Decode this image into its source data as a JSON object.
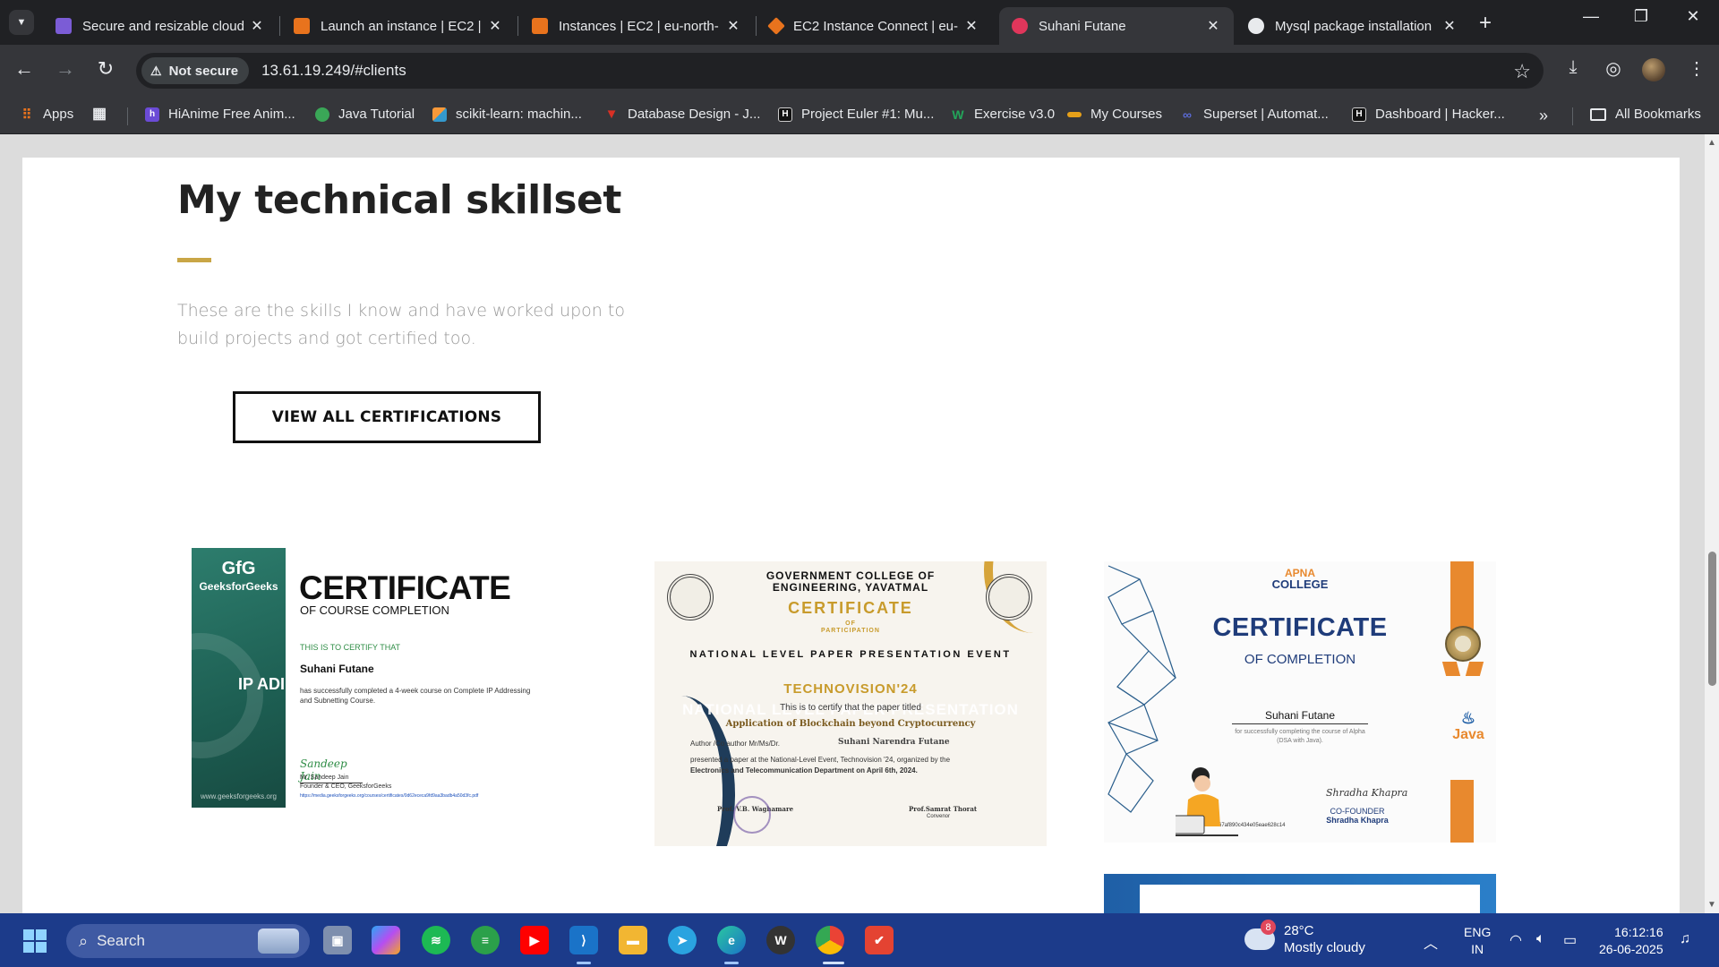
{
  "browser": {
    "tabs": [
      {
        "title": "Secure and resizable cloud",
        "favicon_color": "#7b5cd6"
      },
      {
        "title": "Launch an instance | EC2 | e",
        "favicon_color": "#e8731d"
      },
      {
        "title": "Instances | EC2 | eu-north-",
        "favicon_color": "#e8731d"
      },
      {
        "title": "EC2 Instance Connect | eu-",
        "favicon_color": "#e8731d"
      },
      {
        "title": "Suhani Futane",
        "favicon_color": "#e0365b",
        "active": true
      },
      {
        "title": "Mysql package installation",
        "favicon_color": "#e8eaed"
      }
    ],
    "new_tab_label": "+",
    "address": {
      "security_label": "Not secure",
      "url": "13.61.19.249/#clients"
    },
    "bookmarks": [
      {
        "label": "Apps",
        "icon_color": "#e8731d"
      },
      {
        "label": "HiAnime Free Anim...",
        "icon_color": "#6b4bd6"
      },
      {
        "label": "Java Tutorial",
        "icon_color": "#3aa757"
      },
      {
        "label": "scikit-learn: machin...",
        "icon_color": "#3499cd"
      },
      {
        "label": "Database Design - J...",
        "icon_color": "#d93025"
      },
      {
        "label": "Project Euler #1: Mu...",
        "icon_color": "#111111"
      },
      {
        "label": "Exercise v3.0",
        "icon_color": "#23a55a"
      },
      {
        "label": "My Courses",
        "icon_color": "#e6a019"
      },
      {
        "label": "Superset | Automat...",
        "icon_color": "#5b6bd6"
      },
      {
        "label": "Dashboard | Hacker...",
        "icon_color": "#111111"
      }
    ],
    "bookmarks_more": "»",
    "all_bookmarks_label": "All Bookmarks"
  },
  "page": {
    "section_title": "My technical skillset",
    "section_description": "These are the skills I know and have worked upon to build projects and got certified too.",
    "cta_label": "VIEW ALL CERTIFICATIONS",
    "accent_color": "#c9a646",
    "certificates": {
      "gfg": {
        "logo": "GfG",
        "brand": "GeeksforGeeks",
        "side_text": "IP ADI",
        "side_url": "www.geeksforgeeks.org",
        "heading": "CERTIFICATE",
        "subheading": "OF COURSE COMPLETION",
        "certify": "THIS IS TO CERTIFY THAT",
        "name": "Suhani Futane",
        "body": "has successfully completed a 4-week course on Complete IP Addressing and Subnetting Course.",
        "signature": "Sandeep Jain",
        "signer": "Mr. Sandeep Jain",
        "signer_title": "Founder & CEO, GeeksforGeeks",
        "link": "https://media.geeksforgeeks.org/courses/certificates/0d62ececa9fd9aa3badb4a50d3fc.pdf"
      },
      "gce": {
        "college": "GOVERNMENT COLLEGE OF ENGINEERING, YAVATMAL",
        "heading": "CERTIFICATE",
        "heading_of": "OF",
        "heading_sub": "PARTICIPATION",
        "event": "NATIONAL LEVEL PAPER PRESENTATION EVENT",
        "event_name": "TECHNOVISION'24",
        "overlay": "NATIONAL LEVEL PAPER PRESENTATION",
        "certify_line": "This is to certify that the paper titled",
        "paper_title": "Application of Blockchain beyond Cryptocurrency",
        "author_label": "Author /Co author Mr/Ms/Dr.",
        "author_name": "Suhani Narendra Futane",
        "presented_line1": "presented a paper at the National-Level Event, Technovision '24, organized by the",
        "presented_line2": "Electronics and Telecommunication Department on April 6th, 2024.",
        "signer_left": "Prof. V.B. Waghamare",
        "signer_right": "Prof.Samrat Thorat",
        "signer_right_role": "Convenor"
      },
      "apna": {
        "logo_top": "APNA",
        "logo_bottom": "COLLEGE",
        "heading": "CERTIFICATE",
        "subheading": "OF COMPLETION",
        "name": "Suhani Futane",
        "body": "for successfully completing the course of Alpha (DSA with Java).",
        "badge_text": "Java",
        "signature": "Shradha Khapra",
        "signer_role": "CO-FOUNDER",
        "signer_name": "Shradha Khapra",
        "cert_id": "67af890c434e05eae628c14"
      }
    }
  },
  "taskbar": {
    "search_placeholder": "Search",
    "weather": {
      "badge": "8",
      "temp": "28°C",
      "condition": "Mostly cloudy"
    },
    "language": {
      "line1": "ENG",
      "line2": "IN"
    },
    "time": "16:12:16",
    "date": "26-06-2025"
  }
}
